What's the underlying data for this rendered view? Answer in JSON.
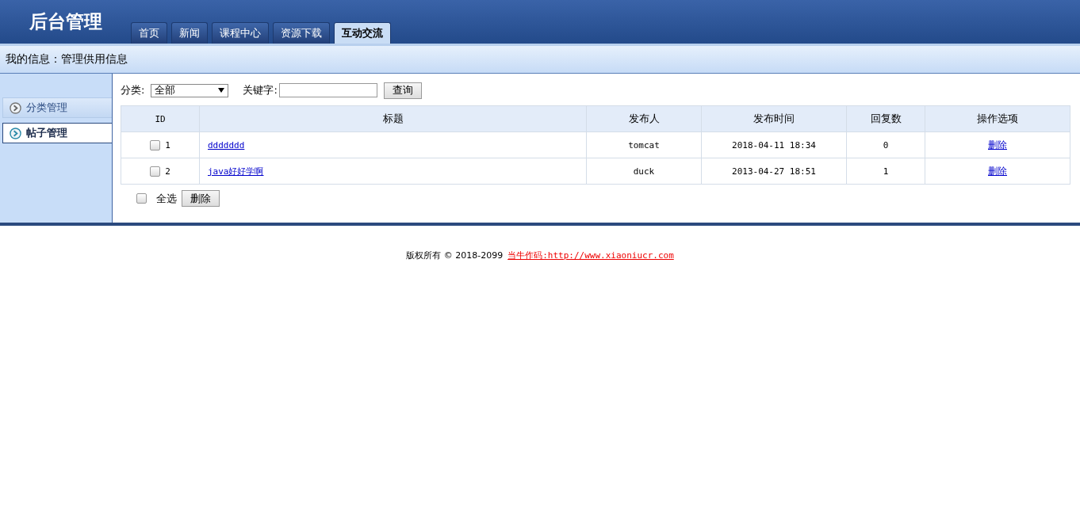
{
  "header": {
    "title": "后台管理",
    "tabs": [
      {
        "label": "首页",
        "selected": false
      },
      {
        "label": "新闻",
        "selected": false
      },
      {
        "label": "课程中心",
        "selected": false
      },
      {
        "label": "资源下载",
        "selected": false
      },
      {
        "label": "互动交流",
        "selected": true
      }
    ]
  },
  "breadcrumb": "我的信息：管理供用信息",
  "sidebar": {
    "items": [
      {
        "label": "分类管理",
        "selected": false
      },
      {
        "label": "帖子管理",
        "selected": true
      }
    ]
  },
  "filter": {
    "category_label": "分类:",
    "category_value": "全部",
    "keyword_label": "关键字:",
    "search_button": "查询"
  },
  "table": {
    "columns": [
      "ID",
      "标题",
      "发布人",
      "发布时间",
      "回复数",
      "操作选项"
    ],
    "rows": [
      {
        "checked": false,
        "id": "1",
        "title": "ddddddd",
        "author": "tomcat",
        "time": "2018-04-11 18:34",
        "replies": "0",
        "action": "删除"
      },
      {
        "checked": false,
        "id": "2",
        "title": "java好好学啊",
        "author": "duck",
        "time": "2013-04-27 18:51",
        "replies": "1",
        "action": "删除"
      }
    ]
  },
  "bulk": {
    "select_all_label": "全选",
    "select_all_checked": false,
    "delete_button": "删除"
  },
  "footer": {
    "copyright": "版权所有 © 2018-2099",
    "link": "当牛作码:http://www.xiaoniucr.com"
  }
}
